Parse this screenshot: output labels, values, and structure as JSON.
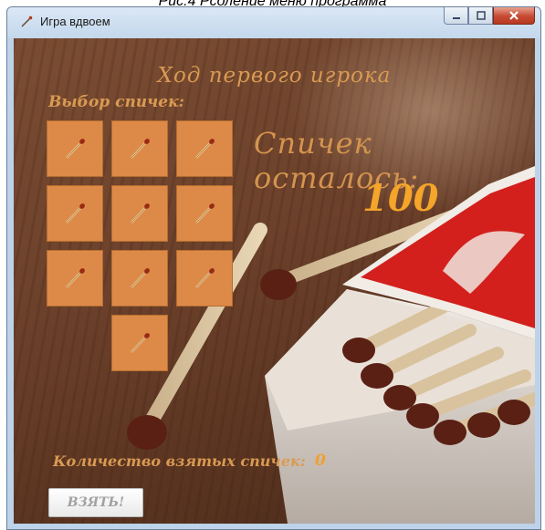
{
  "caption": "Рис.4 Рсоление меню программа",
  "window": {
    "title": "Игра вдвоем",
    "controls": [
      "minimize",
      "maximize",
      "close"
    ]
  },
  "game": {
    "turn_heading": "Ход первого игрока",
    "picks_label": "Выбор спичек:",
    "remaining_label": "Спичек осталось:",
    "remaining_value": "100",
    "taken_label": "Количество взятых спичек:",
    "taken_value": "0",
    "take_button": "ВЗЯТЬ!",
    "tiles": [
      {
        "icon": "match-icon"
      },
      {
        "icon": "match-icon"
      },
      {
        "icon": "match-icon"
      },
      {
        "icon": "match-icon"
      },
      {
        "icon": "match-icon"
      },
      {
        "icon": "match-icon"
      },
      {
        "icon": "match-icon"
      },
      {
        "icon": "match-icon"
      },
      {
        "icon": "match-icon"
      },
      {
        "icon": "match-icon"
      }
    ]
  },
  "colors": {
    "accent_text": "#d99a52",
    "counter_text": "#f4a52a",
    "tile_fill": "#dd8a48"
  }
}
